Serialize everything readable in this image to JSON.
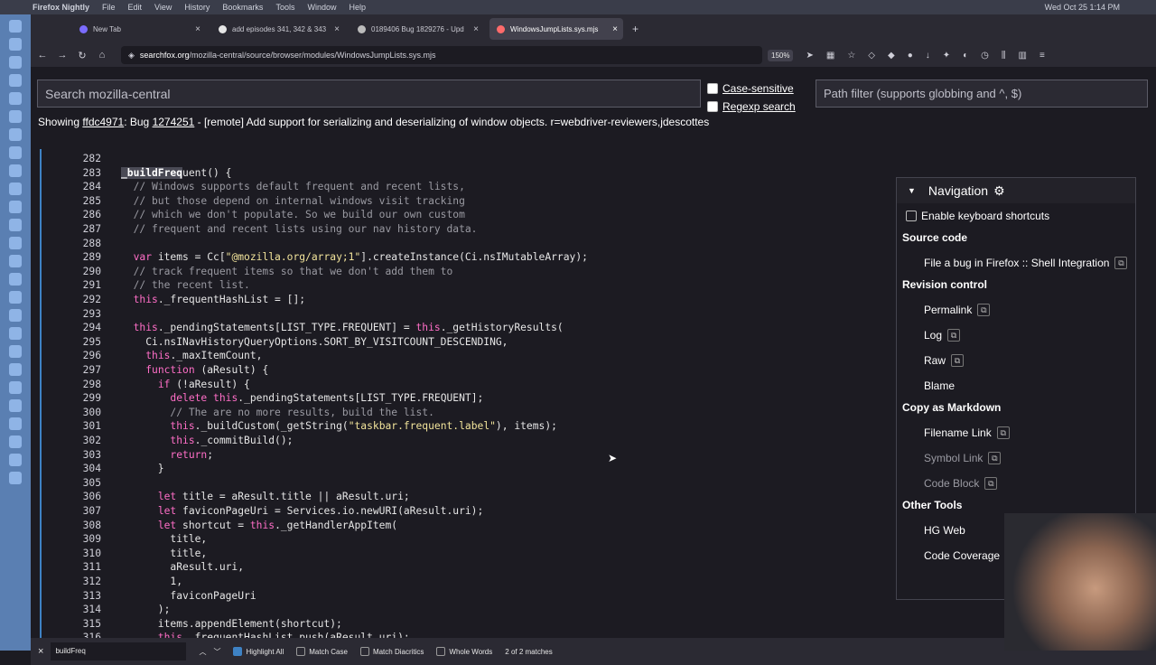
{
  "menubar": {
    "app": "Firefox Nightly",
    "items": [
      "File",
      "Edit",
      "View",
      "History",
      "Bookmarks",
      "Tools",
      "Window",
      "Help"
    ],
    "clock": "Wed Oct 25  1:14 PM"
  },
  "tabs": [
    {
      "label": "New Tab",
      "color": "#7b6cff"
    },
    {
      "label": "add episodes 341, 342 & 343",
      "color": "#e6e6e6"
    },
    {
      "label": "0189406 Bug 1829276 - Upd",
      "color": "#bbbbbb"
    },
    {
      "label": "WindowsJumpLists.sys.mjs",
      "color": "#ff6b6b",
      "active": true
    }
  ],
  "urlbar": {
    "domain": "searchfox.org",
    "path": "/mozilla-central/source/browser/modules/WindowsJumpLists.sys.mjs",
    "zoom": "150%"
  },
  "searchfox": {
    "search_placeholder": "Search mozilla-central",
    "case_label": "Case-sensitive",
    "regexp_label": "Regexp search",
    "path_placeholder": "Path filter (supports globbing and ^, $)",
    "showing_prefix": "Showing",
    "commit": "ffdc4971",
    "bug_prefix": ": Bug",
    "bug": "1274251",
    "showing_rest": " - [remote] Add support for serializing and deserializing of window objects. r=webdriver-reviewers,jdescottes"
  },
  "code": [
    {
      "n": "282",
      "t": ""
    },
    {
      "n": "283",
      "t": "_buildFrequent() {",
      "hl": true
    },
    {
      "n": "284",
      "t": "  // Windows supports default frequent and recent lists,",
      "c": true
    },
    {
      "n": "285",
      "t": "  // but those depend on internal windows visit tracking",
      "c": true
    },
    {
      "n": "286",
      "t": "  // which we don't populate. So we build our own custom",
      "c": true
    },
    {
      "n": "287",
      "t": "  // frequent and recent lists using our nav history data.",
      "c": true
    },
    {
      "n": "288",
      "t": ""
    },
    {
      "n": "289",
      "t": "  var items = Cc[\"@mozilla.org/array;1\"].createInstance(Ci.nsIMutableArray);"
    },
    {
      "n": "290",
      "t": "  // track frequent items so that we don't add them to",
      "c": true
    },
    {
      "n": "291",
      "t": "  // the recent list.",
      "c": true
    },
    {
      "n": "292",
      "t": "  this._frequentHashList = [];"
    },
    {
      "n": "293",
      "t": ""
    },
    {
      "n": "294",
      "t": "  this._pendingStatements[LIST_TYPE.FREQUENT] = this._getHistoryResults("
    },
    {
      "n": "295",
      "t": "    Ci.nsINavHistoryQueryOptions.SORT_BY_VISITCOUNT_DESCENDING,"
    },
    {
      "n": "296",
      "t": "    this._maxItemCount,"
    },
    {
      "n": "297",
      "t": "    function (aResult) {"
    },
    {
      "n": "298",
      "t": "      if (!aResult) {"
    },
    {
      "n": "299",
      "t": "        delete this._pendingStatements[LIST_TYPE.FREQUENT];"
    },
    {
      "n": "300",
      "t": "        // The are no more results, build the list.",
      "c": true
    },
    {
      "n": "301",
      "t": "        this._buildCustom(_getString(\"taskbar.frequent.label\"), items);"
    },
    {
      "n": "302",
      "t": "        this._commitBuild();"
    },
    {
      "n": "303",
      "t": "        return;"
    },
    {
      "n": "304",
      "t": "      }"
    },
    {
      "n": "305",
      "t": ""
    },
    {
      "n": "306",
      "t": "      let title = aResult.title || aResult.uri;"
    },
    {
      "n": "307",
      "t": "      let faviconPageUri = Services.io.newURI(aResult.uri);"
    },
    {
      "n": "308",
      "t": "      let shortcut = this._getHandlerAppItem("
    },
    {
      "n": "309",
      "t": "        title,"
    },
    {
      "n": "310",
      "t": "        title,"
    },
    {
      "n": "311",
      "t": "        aResult.uri,"
    },
    {
      "n": "312",
      "t": "        1,"
    },
    {
      "n": "313",
      "t": "        faviconPageUri"
    },
    {
      "n": "314",
      "t": "      );"
    },
    {
      "n": "315",
      "t": "      items.appendElement(shortcut);"
    },
    {
      "n": "316",
      "t": "      this._frequentHashList.push(aResult.uri);"
    }
  ],
  "nav": {
    "title": "Navigation",
    "kb_label": "Enable keyboard shortcuts",
    "source_code": "Source code",
    "bug_link": "File a bug in Firefox :: Shell Integration",
    "revision": "Revision control",
    "permalink": "Permalink",
    "log": "Log",
    "raw": "Raw",
    "blame": "Blame",
    "markdown": "Copy as Markdown",
    "filename_link": "Filename Link",
    "symbol_link": "Symbol Link",
    "code_block": "Code Block",
    "other": "Other Tools",
    "hg": "HG Web",
    "coverage": "Code Coverage"
  },
  "findbar": {
    "query": "buildFreq",
    "highlight": "Highlight All",
    "match_case": "Match Case",
    "diacritics": "Match Diacritics",
    "whole": "Whole Words",
    "matches": "2 of 2 matches"
  }
}
